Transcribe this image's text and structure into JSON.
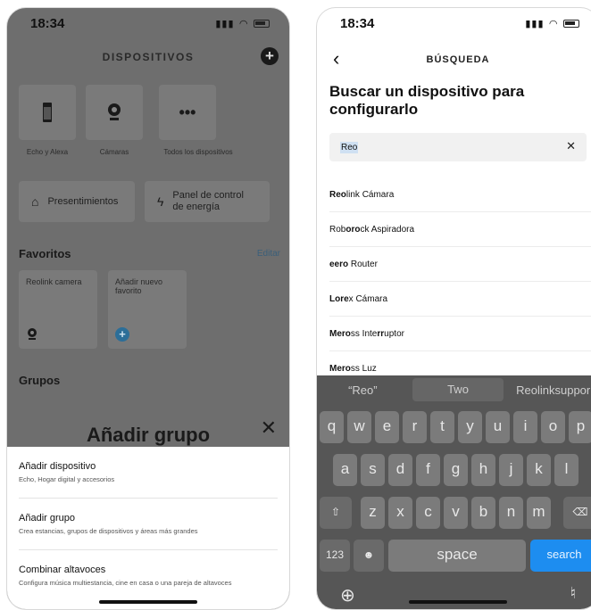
{
  "left": {
    "time": "18:34",
    "title": "DISPOSITIVOS",
    "tiles": [
      {
        "label": "Echo y Alexa"
      },
      {
        "label": "Cámaras"
      },
      {
        "label": "Todos los dispositivos"
      }
    ],
    "presentimientos": "Presentimientos",
    "energy": "Panel de control de energía",
    "favorites_heading": "Favoritos",
    "edit": "Editar",
    "fav_camera": "Reolink camera",
    "fav_add": "Añadir nuevo favorito",
    "groups_heading": "Grupos",
    "sheet_title": "Añadir grupo",
    "sheet_items": [
      {
        "title": "Añadir dispositivo",
        "sub": "Echo, Hogar digital y accesorios"
      },
      {
        "title": "Añadir grupo",
        "sub": "Crea estancias, grupos de dispositivos y áreas más grandes"
      },
      {
        "title": "Combinar altavoces",
        "sub": "Configura música multiestancia, cine en casa o una pareja de altavoces"
      }
    ]
  },
  "right": {
    "time": "18:34",
    "title": "BÚSQUEDA",
    "heading": "Buscar un dispositivo para configurarlo",
    "search_value": "Reo",
    "results": [
      {
        "bold": "Reo",
        "rest": "link Cámara"
      },
      {
        "pre": "Rob",
        "bold": "oro",
        "rest": "ck Aspiradora"
      },
      {
        "bold": "eero",
        "rest": " Router"
      },
      {
        "bold": "Lore",
        "rest": "x Cámara"
      },
      {
        "bold": "Mero",
        "rest": "ss Inte",
        "bold2": "rr",
        "rest2": "uptor"
      },
      {
        "bold": "Mero",
        "rest": "ss Luz"
      }
    ],
    "suggestions": [
      "“Reo”",
      "Two",
      "Reolinksuppor"
    ],
    "row1": [
      "q",
      "w",
      "e",
      "r",
      "t",
      "y",
      "u",
      "i",
      "o",
      "p"
    ],
    "row2": [
      "a",
      "s",
      "d",
      "f",
      "g",
      "h",
      "j",
      "k",
      "l"
    ],
    "row3": [
      "z",
      "x",
      "c",
      "v",
      "b",
      "n",
      "m"
    ],
    "num_key": "123",
    "space_key": "space",
    "search_key": "search"
  }
}
